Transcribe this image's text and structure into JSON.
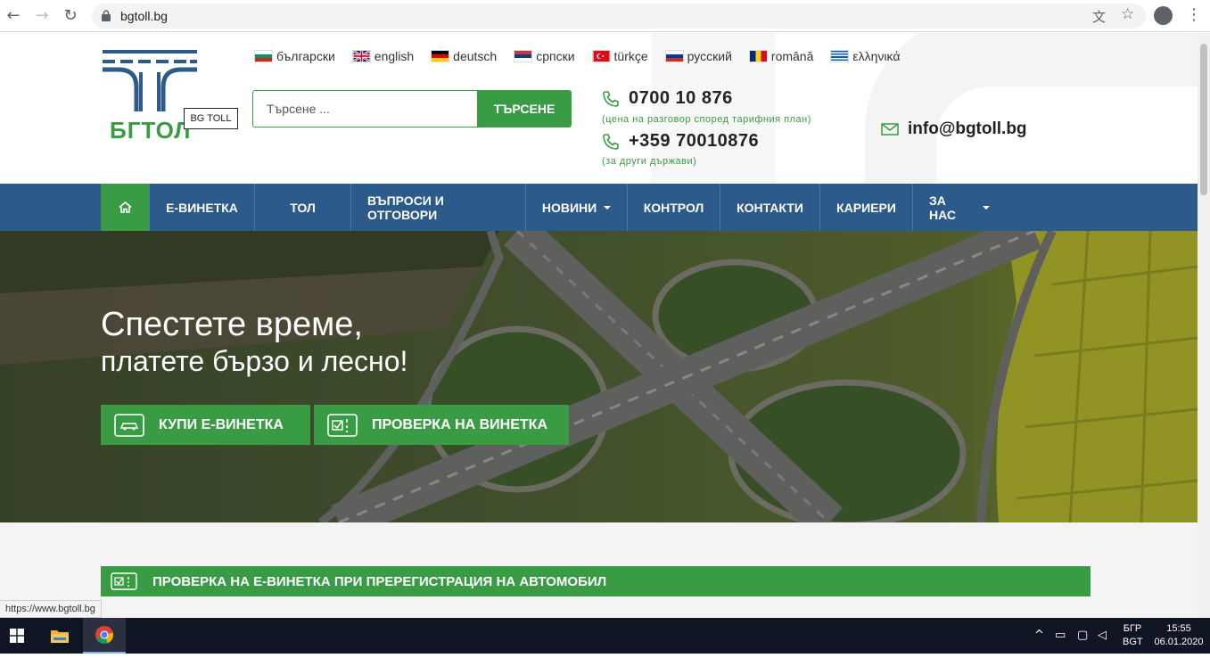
{
  "browser": {
    "url": "bgtoll.bg",
    "status_url": "https://www.bgtoll.bg",
    "back_icon": "←",
    "forward_icon": "→",
    "reload_icon": "↻",
    "translate_icon": "文",
    "star_icon": "☆",
    "menu_icon": "⋮"
  },
  "header": {
    "logo_text": "БГТОЛ",
    "logo_badge": "BG TOLL",
    "languages": [
      {
        "label": "български",
        "flag": "bg"
      },
      {
        "label": "english",
        "flag": "gb"
      },
      {
        "label": "deutsch",
        "flag": "de"
      },
      {
        "label": "српски",
        "flag": "rs"
      },
      {
        "label": "türkçe",
        "flag": "tr"
      },
      {
        "label": "русский",
        "flag": "ru"
      },
      {
        "label": "română",
        "flag": "ro"
      },
      {
        "label": "ελληνικά",
        "flag": "gr"
      }
    ],
    "search_placeholder": "Търсене ...",
    "search_button": "ТЪРСЕНЕ",
    "phone1": "0700 10 876",
    "phone1_note": "(цена на разговор според тарифния план)",
    "phone2": "+359 70010876",
    "phone2_note": "(за други държави)",
    "email": "info@bgtoll.bg"
  },
  "nav": {
    "items": [
      {
        "label": "Е-ВИНЕТКА"
      },
      {
        "label": "ТОЛ"
      },
      {
        "label": "ВЪПРОСИ И ОТГОВОРИ"
      },
      {
        "label": "НОВИНИ"
      },
      {
        "label": "КОНТРОЛ"
      },
      {
        "label": "КОНТАКТИ"
      },
      {
        "label": "КАРИЕРИ"
      },
      {
        "label": "ЗА НАС"
      }
    ]
  },
  "hero": {
    "title": "Спестете време,",
    "subtitle": "платете бързо и лесно!",
    "buy_button": "КУПИ Е-ВИНЕТКА",
    "check_button": "ПРОВЕРКА НА ВИНЕТКА"
  },
  "section": {
    "check_reg_title": "ПРОВЕРКА НА Е-ВИНЕТКА ПРИ ПРЕРЕГИСТРАЦИЯ НА АВТОМОБИЛ"
  },
  "taskbar": {
    "lang_top": "БГР",
    "lang_bottom": "BGT",
    "time": "15:55",
    "date": "06.01.2020"
  },
  "colors": {
    "green": "#3a9b45",
    "nav_blue": "#2c5a8a"
  }
}
